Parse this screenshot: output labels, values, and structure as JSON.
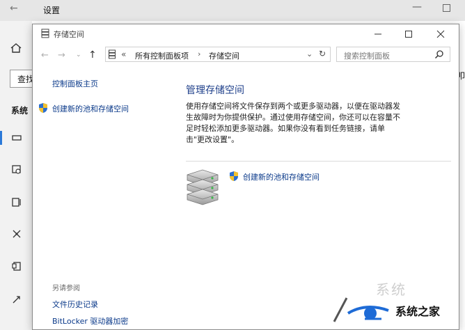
{
  "background_window": {
    "back_glyph": "←",
    "title": "设置",
    "min_glyph": "—",
    "search_label": "查找",
    "system_label": "系统",
    "help_glyph": "?",
    "right_edge_text": "叩",
    "watermark_ghost": "系统"
  },
  "window": {
    "title": "存储空间",
    "controls": {
      "minimize": "—",
      "maximize": "☐",
      "close": "✕"
    },
    "nav": {
      "back": "←",
      "forward": "→",
      "dropdown": "⌄",
      "up": "↑"
    },
    "address": {
      "chevrons": "«",
      "crumbs": [
        "所有控制面板项",
        "存储空间"
      ],
      "separator": "›",
      "dropdown": "⌄",
      "refresh": "↻"
    },
    "search": {
      "placeholder": "搜索控制面板"
    }
  },
  "sidebar": {
    "home_link": "控制面板主页",
    "create_link": "创建新的池和存储空间",
    "see_also_heading": "另请参阅",
    "see_also_links": [
      "文件历史记录",
      "BitLocker 驱动器加密"
    ]
  },
  "main": {
    "heading": "管理存储空间",
    "description": "使用存储空间将文件保存到两个或更多驱动器，以便在驱动器发生故障时为你提供保护。通过使用存储空间，你还可以在容量不足时轻松添加更多驱动器。如果你没有看到任务链接，请单击\"更改设置\"。",
    "create_link": "创建新的池和存储空间"
  },
  "watermark": {
    "text": "系统之家"
  },
  "colors": {
    "link": "#0b3a8a",
    "heading": "#1e3f8a",
    "shield_blue": "#2b6fd1",
    "shield_yellow": "#f2c230",
    "accent": "#2b79d8"
  }
}
